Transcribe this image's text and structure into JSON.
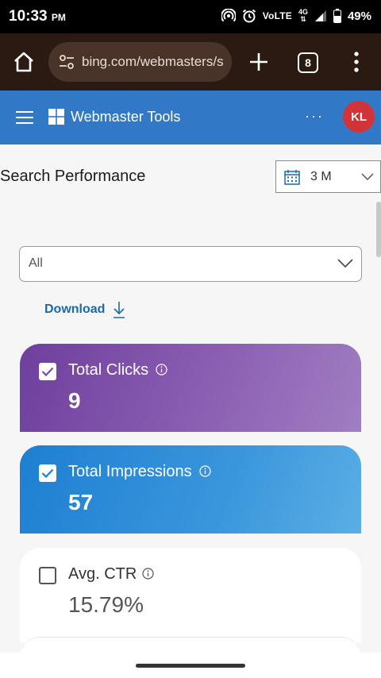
{
  "status": {
    "time": "10:33",
    "ampm": "PM",
    "volte": "VoLTE",
    "network": "4G",
    "battery": "49%"
  },
  "browser": {
    "url": "bing.com/webmasters/s",
    "tab_count": "8"
  },
  "header": {
    "title": "Webmaster Tools",
    "more": "···",
    "avatar_initials": "KL",
    "avatar_color": "#d13438",
    "brand_color": "#3178c6"
  },
  "performance": {
    "title": "Search Performance",
    "date_range": "3 M",
    "filter_value": "All",
    "download_label": "Download"
  },
  "cards": [
    {
      "label": "Total Clicks",
      "value": "9",
      "checked": true
    },
    {
      "label": "Total Impressions",
      "value": "57",
      "checked": true
    },
    {
      "label": "Avg. CTR",
      "value": "15.79%",
      "checked": false
    }
  ]
}
